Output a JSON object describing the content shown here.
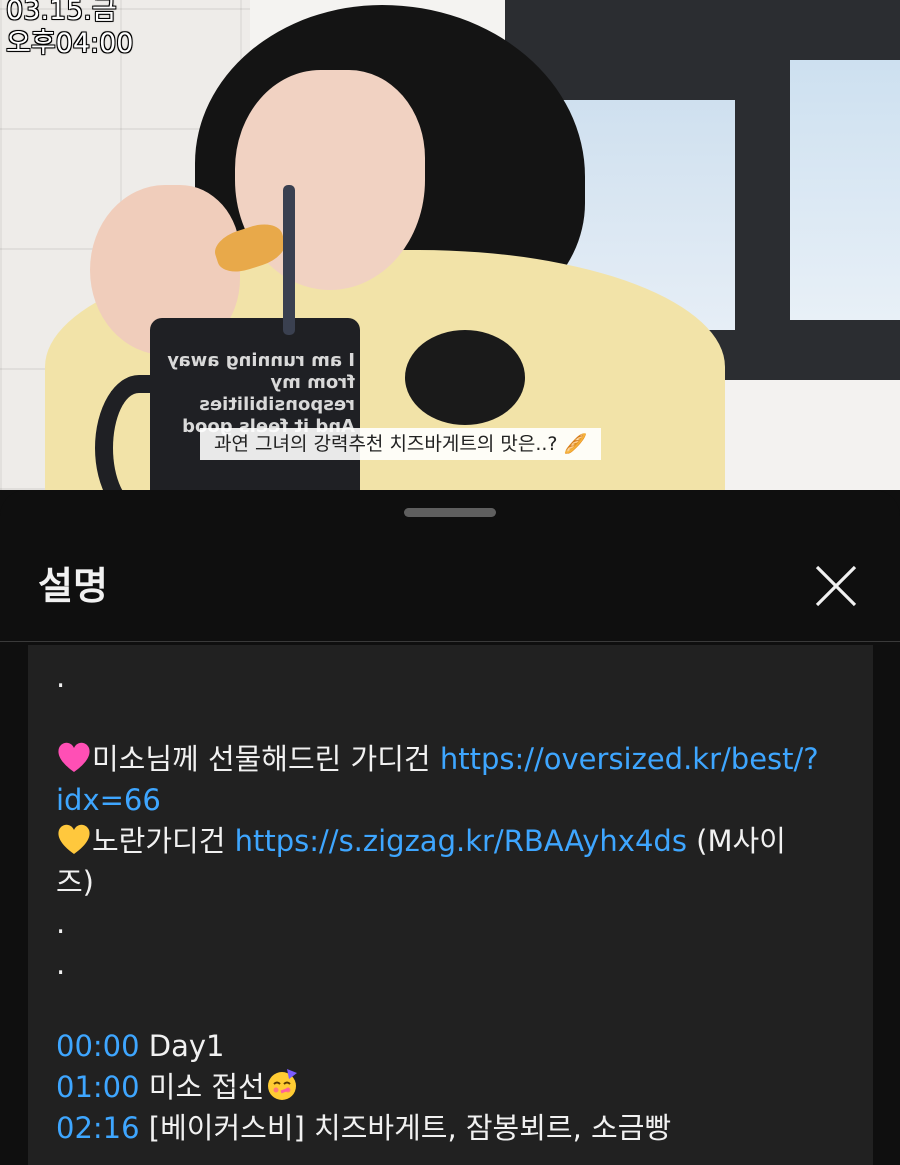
{
  "video": {
    "timestamp_date": "03.15.금",
    "timestamp_time": "오후04:00",
    "cup_text": "I am running away from my responsibilities And it feels good",
    "caption": "과연 그녀의 강력추천 치즈바게트의 맛은..? 🥖"
  },
  "sheet": {
    "title": "설명",
    "close_icon": "close-icon"
  },
  "description": {
    "dot1": ".",
    "gift_text": "미소님께 선물해드린 가디건",
    "gift_link_1": "https://oversized.kr/best/?",
    "gift_link_2": "idx=66",
    "gift_emoji": "pink-heart-icon",
    "yellow_emoji": "yellow-heart-icon",
    "yellow_text": "노란가디건",
    "yellow_link": "https://s.zigzag.kr/RBAAyhx4ds",
    "yellow_size_1": "(M사이",
    "yellow_size_2": "즈)",
    "dot2": ".",
    "dot3": ".",
    "chapters": [
      {
        "time": "00:00",
        "label": "Day1"
      },
      {
        "time": "01:00",
        "label": "미소 접선"
      },
      {
        "time": "02:16",
        "label": "[베이커스비] 치즈바게트, 잠봉뵈르, 소금빵"
      }
    ]
  },
  "colors": {
    "background": "#0f0f0f",
    "card": "#212121",
    "link": "#3ea6ff",
    "text": "#f1f1f1"
  }
}
